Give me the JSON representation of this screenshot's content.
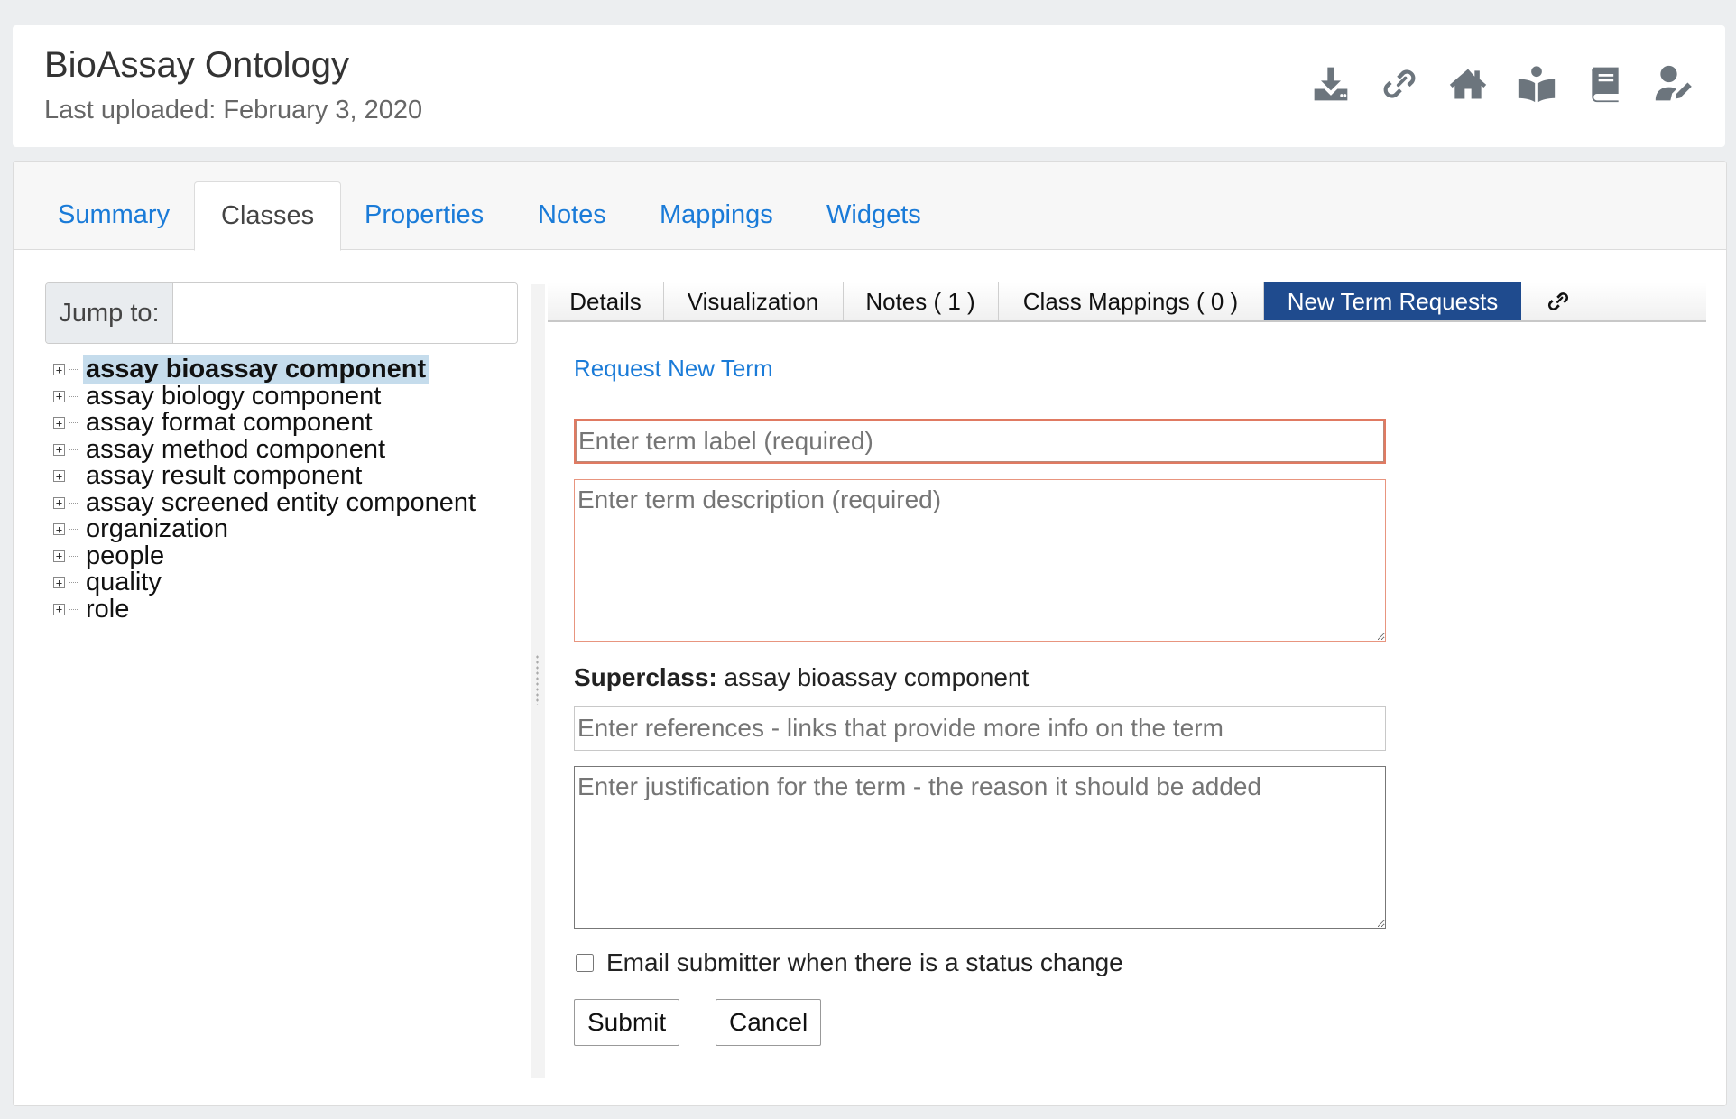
{
  "header": {
    "title": "BioAssay Ontology",
    "subtitle": "Last uploaded: February 3, 2020",
    "icons": [
      "download-icon",
      "link-icon",
      "home-icon",
      "reader-icon",
      "book-icon",
      "user-edit-icon"
    ]
  },
  "tabs": {
    "summary": "Summary",
    "classes": "Classes",
    "properties": "Properties",
    "notes": "Notes",
    "mappings": "Mappings",
    "widgets": "Widgets",
    "active": "Classes"
  },
  "jump": {
    "label": "Jump to:",
    "value": ""
  },
  "tree": {
    "expander_symbol": "+",
    "items": [
      "assay bioassay component",
      "assay biology component",
      "assay format component",
      "assay method component",
      "assay result component",
      "assay screened entity component",
      "organization",
      "people",
      "quality",
      "role"
    ],
    "selected": "assay bioassay component"
  },
  "subtabs": {
    "details": "Details",
    "visualization": "Visualization",
    "notes": "Notes ( 1 )",
    "class_mappings": "Class Mappings ( 0 )",
    "new_term_requests": "New Term Requests",
    "active": "New Term Requests",
    "link_icon": "link-icon"
  },
  "form": {
    "request_link": "Request New Term",
    "label_placeholder": "Enter term label (required)",
    "description_placeholder": "Enter term description (required)",
    "superclass_label": "Superclass:",
    "superclass_value": " assay bioassay component",
    "references_placeholder": "Enter references - links that provide more info on the term",
    "justification_placeholder": "Enter justification for the term - the reason it should be added",
    "email_label": "Email submitter when there is a status change",
    "submit_label": "Submit",
    "cancel_label": "Cancel"
  },
  "colors": {
    "accent_link": "#1a7bd8",
    "active_subtab": "#1f4b8e",
    "selected_tree_bg": "#c5dcec",
    "required_border": "#e07a62"
  }
}
